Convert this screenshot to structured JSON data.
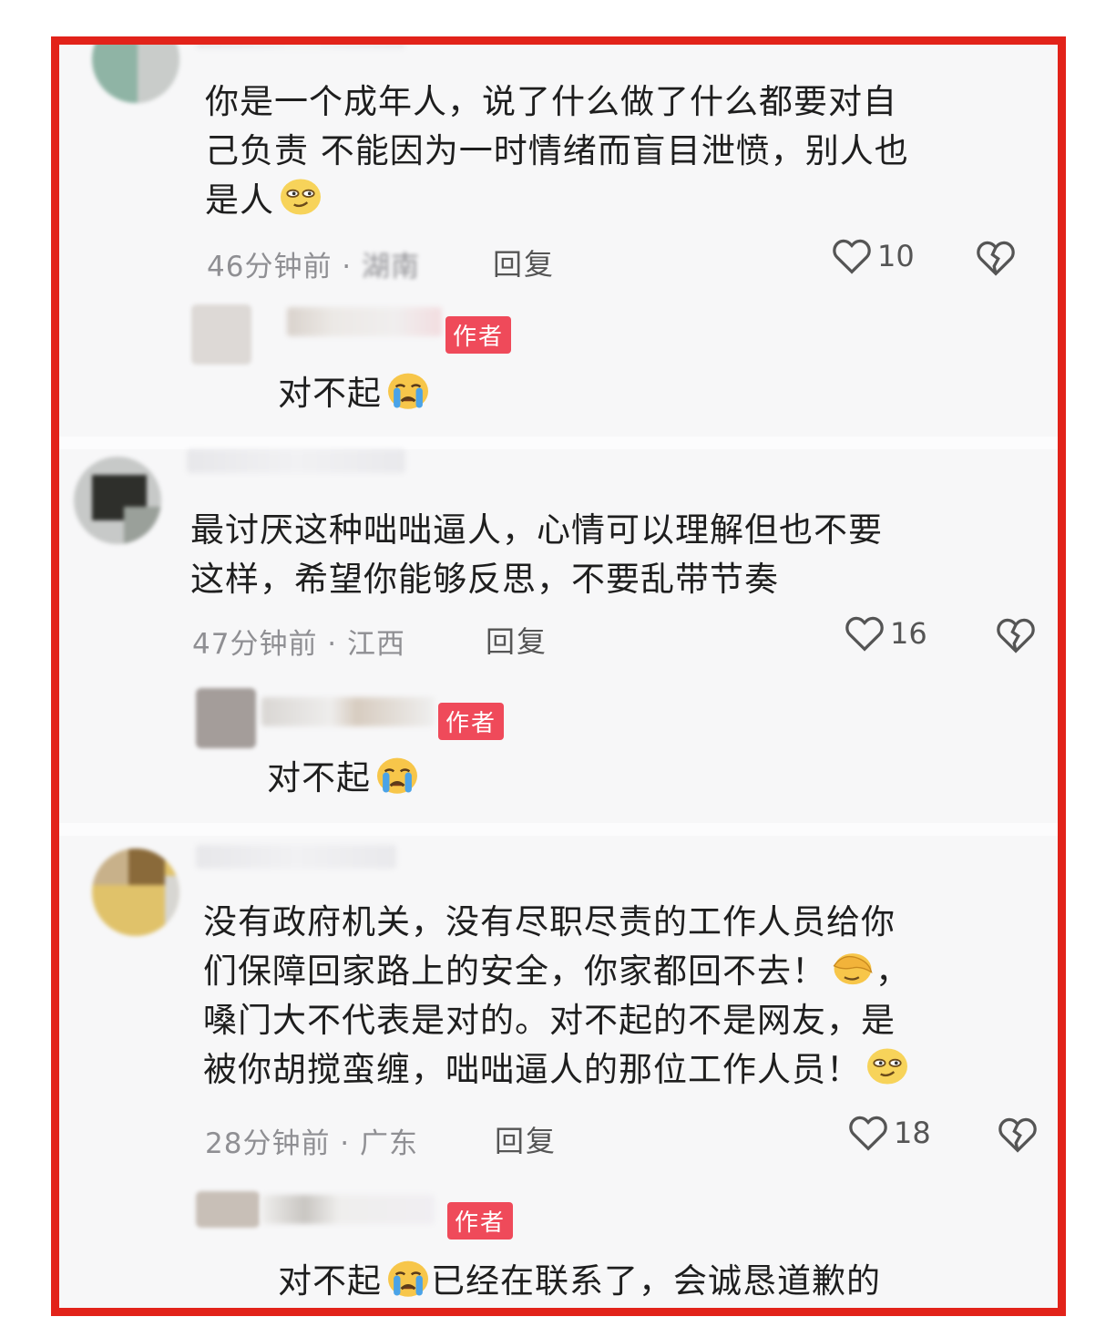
{
  "comments": [
    {
      "text_lines": [
        "你是一个成年人，说了什么做了什么都要对自",
        "己负责 不能因为一时情绪而盲目泄愤，别人也",
        "是人"
      ],
      "time": "46分钟前",
      "location": "湖南",
      "reply_label": "回复",
      "likes": "10",
      "author_reply": {
        "badge": "作者",
        "text": "对不起"
      }
    },
    {
      "text_lines": [
        "最讨厌这种咄咄逼人，心情可以理解但也不要",
        "这样，希望你能够反思，不要乱带节奏"
      ],
      "time": "47分钟前",
      "location": "江西",
      "reply_label": "回复",
      "likes": "16",
      "author_reply": {
        "badge": "作者",
        "text": "对不起"
      }
    },
    {
      "text_lines": [
        "没有政府机关，没有尽职尽责的工作人员给你",
        "们保障回家路上的安全，你家都回不去！",
        "嗓门大不代表是对的。对不起的不是网友，是",
        "被你胡搅蛮缠，咄咄逼人的那位工作人员！"
      ],
      "time": "28分钟前",
      "location": "广东",
      "reply_label": "回复",
      "likes": "18",
      "author_reply": {
        "badge": "作者",
        "text": "对不起",
        "text_after": "已经在联系了，会诚恳道歉的"
      }
    }
  ],
  "separator": " · ",
  "comma_after_emoji": "，",
  "icons": {
    "like": "heart-outline-icon",
    "dislike": "broken-heart-icon",
    "emoji_1": "smirk-face-icon",
    "emoji_cry": "crying-face-icon",
    "emoji_facepalm": "facepalm-face-icon",
    "emoji_smirk": "smirk-face-icon"
  },
  "colors": {
    "frame_border": "#e2231a",
    "author_badge": "#ef4a5a",
    "meta_text": "#8f8f93"
  }
}
